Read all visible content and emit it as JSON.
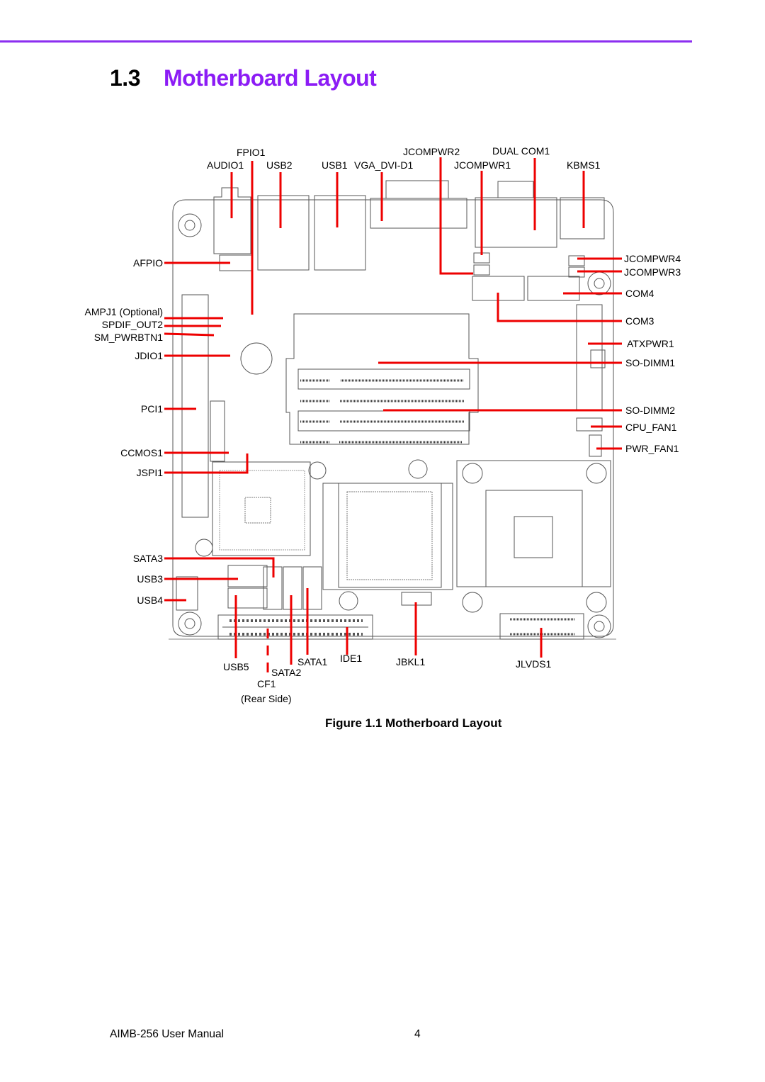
{
  "section": {
    "number": "1.3",
    "title": "Motherboard Layout"
  },
  "colors": {
    "accent": "#8c1cf5",
    "rule": "#8c2ef0",
    "leader": "#ee0000",
    "outline": "#555555"
  },
  "figure": {
    "caption": "Figure 1.1 Motherboard Layout",
    "labels": {
      "fpio1": "FPIO1",
      "audio1": "AUDIO1",
      "usb2": "USB2",
      "usb1": "USB1",
      "vga_dvi_d1": "VGA_DVI-D1",
      "jcompwr2": "JCOMPWR2",
      "jcompwr1": "JCOMPWR1",
      "dual_com1": "DUAL COM1",
      "kbms1": "KBMS1",
      "afpio": "AFPIO",
      "ampj1": "AMPJ1 (Optional)",
      "spdif_out2": "SPDIF_OUT2",
      "sm_pwrbtn1": "SM_PWRBTN1",
      "jdio1": "JDIO1",
      "pci1": "PCI1",
      "ccmos1": "CCMOS1",
      "jspi1": "JSPI1",
      "sata3": "SATA3",
      "usb3": "USB3",
      "usb4": "USB4",
      "jcompwr4": "JCOMPWR4",
      "jcompwr3": "JCOMPWR3",
      "com4": "COM4",
      "com3": "COM3",
      "atxpwr1": "ATXPWR1",
      "so_dimm1": "SO-DIMM1",
      "so_dimm2": "SO-DIMM2",
      "cpu_fan1": "CPU_FAN1",
      "pwr_fan1": "PWR_FAN1",
      "usb5": "USB5",
      "sata1": "SATA1",
      "sata2": "SATA2",
      "ide1": "IDE1",
      "jbkl1": "JBKL1",
      "jlvds1": "JLVDS1",
      "cf1": "CF1",
      "cf1_note": "(Rear Side)"
    }
  },
  "footer": {
    "manual": "AIMB-256 User Manual",
    "page": "4"
  }
}
